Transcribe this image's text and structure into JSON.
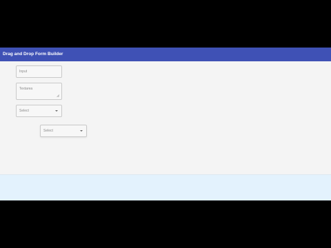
{
  "app": {
    "title": "Drag and Drop Form Builder",
    "bar_color": "#3f51b5",
    "drop_zone_color": "#e3f2fd"
  },
  "form": {
    "input": {
      "placeholder": "Input"
    },
    "textarea": {
      "placeholder": "Textarea",
      "resize_icon": "resize-grip-icon"
    },
    "select": {
      "placeholder": "Select",
      "caret_icon": "dropdown-caret-icon"
    },
    "dragged_select": {
      "placeholder": "Select",
      "caret_icon": "dropdown-caret-icon"
    }
  }
}
